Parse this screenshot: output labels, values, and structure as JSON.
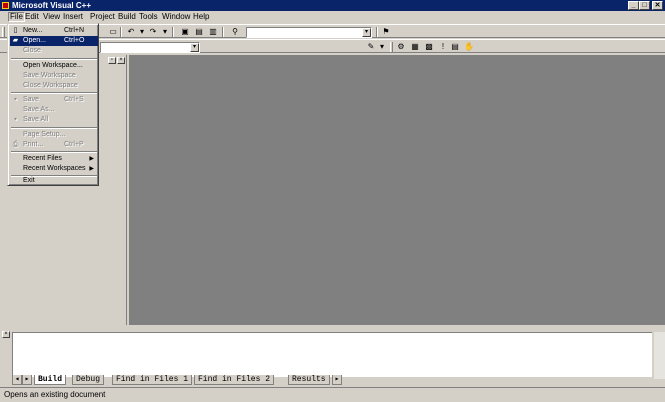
{
  "window": {
    "title": "Microsoft Visual C++",
    "controls": [
      "_",
      "□",
      "✕"
    ]
  },
  "menubar": {
    "items": [
      "File",
      "Edit",
      "View",
      "Insert",
      "Project",
      "Build",
      "Tools",
      "Window",
      "Help"
    ]
  },
  "file_menu": {
    "items": [
      {
        "label": "New...",
        "shortcut": "Ctrl+N",
        "state": "normal",
        "icon": "new-doc-icon",
        "glyph": "▯"
      },
      {
        "label": "Open...",
        "shortcut": "Ctrl+O",
        "state": "highlighted",
        "icon": "open-folder-icon",
        "glyph": "▰"
      },
      {
        "label": "Close",
        "shortcut": "",
        "state": "disabled"
      },
      {
        "label": "Open Workspace...",
        "shortcut": "",
        "state": "normal"
      },
      {
        "label": "Save Workspace",
        "shortcut": "",
        "state": "disabled"
      },
      {
        "label": "Close Workspace",
        "shortcut": "",
        "state": "disabled"
      },
      {
        "label": "Save",
        "shortcut": "Ctrl+S",
        "state": "disabled",
        "icon": "save-icon",
        "glyph": "▪"
      },
      {
        "label": "Save As...",
        "shortcut": "",
        "state": "disabled"
      },
      {
        "label": "Save All",
        "shortcut": "",
        "state": "disabled",
        "icon": "save-all-icon",
        "glyph": "▪"
      },
      {
        "label": "Page Setup...",
        "shortcut": "",
        "state": "disabled"
      },
      {
        "label": "Print...",
        "shortcut": "Ctrl+P",
        "state": "disabled",
        "icon": "print-icon",
        "glyph": "⎙"
      },
      {
        "label": "Recent Files",
        "shortcut": "",
        "state": "normal",
        "submenu": true
      },
      {
        "label": "Recent Workspaces",
        "shortcut": "",
        "state": "normal",
        "submenu": true
      },
      {
        "label": "Exit",
        "shortcut": "",
        "state": "normal"
      }
    ]
  },
  "output": {
    "tabs": [
      "Build",
      "Debug",
      "Find in Files 1",
      "Find in Files 2",
      "Results"
    ],
    "selected_tab": "Build"
  },
  "status": {
    "text": "Opens an existing document"
  },
  "colors": {
    "titlebar": "#0a246a",
    "face": "#d4d0c8",
    "mdi_background": "#808080"
  }
}
